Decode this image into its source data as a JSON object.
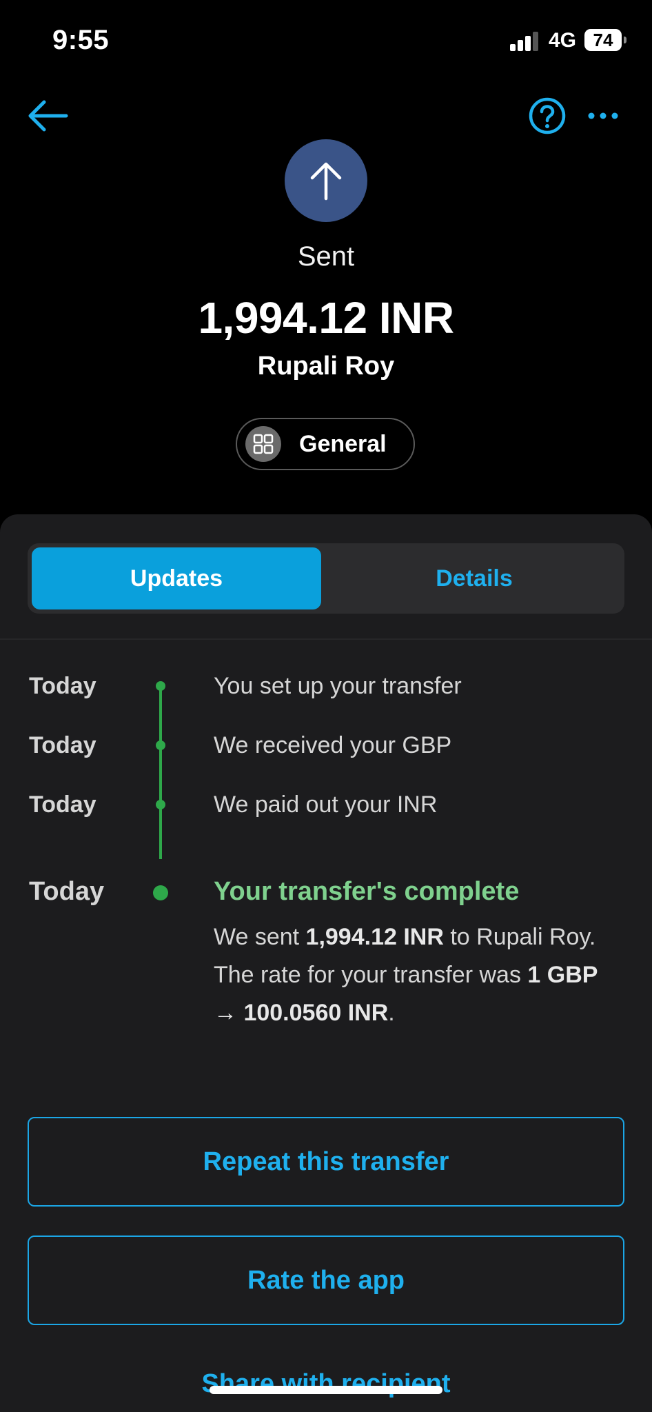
{
  "status_bar": {
    "time": "9:55",
    "network": "4G",
    "battery": "74"
  },
  "nav": {
    "back_icon": "arrow-left-icon",
    "help_icon": "question-circle-icon",
    "more_icon": "ellipsis-icon"
  },
  "hero": {
    "icon": "arrow-up-icon",
    "status": "Sent",
    "amount": "1,994.12 INR",
    "recipient": "Rupali Roy",
    "category_label": "General",
    "category_icon": "grid-icon"
  },
  "tabs": [
    {
      "label": "Updates",
      "active": true
    },
    {
      "label": "Details",
      "active": false
    }
  ],
  "timeline": [
    {
      "date": "Today",
      "text": "You set up your transfer"
    },
    {
      "date": "Today",
      "text": "We received your GBP"
    },
    {
      "date": "Today",
      "text": "We paid out your INR"
    }
  ],
  "final_event": {
    "date": "Today",
    "title": "Your transfer's complete",
    "body_part1": "We sent ",
    "amount": "1,994.12 INR",
    "body_part2": " to Rupali Roy. The rate for your transfer was ",
    "rate": "1 GBP → 100.0560 INR",
    "body_part3": "."
  },
  "actions": {
    "repeat": "Repeat this transfer",
    "rate_app": "Rate the app",
    "share": "Share with recipient"
  },
  "colors": {
    "accent": "#1fb0ee",
    "active_tab": "#0aa0dc",
    "success": "#2ea84a",
    "success_text": "#7fd18e",
    "hero_circle": "#3a5488",
    "sheet": "#1c1c1e"
  }
}
